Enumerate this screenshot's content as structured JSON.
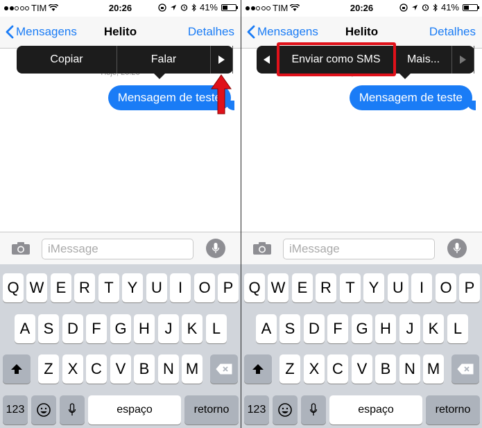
{
  "status_bar": {
    "carrier": "TIM",
    "time": "20:26",
    "battery": "41%",
    "battery_level": 0.41
  },
  "nav": {
    "back_label": "Mensagens",
    "title": "Helito",
    "details_label": "Detalhes"
  },
  "conversation": {
    "timestamp": "Hoje, 20:26",
    "message": "Mensagem de teste"
  },
  "left_menu": {
    "items": [
      "Copiar",
      "Falar"
    ]
  },
  "right_menu": {
    "items": [
      "Enviar como SMS",
      "Mais..."
    ]
  },
  "input": {
    "placeholder": "iMessage"
  },
  "keyboard": {
    "row1": [
      "Q",
      "W",
      "E",
      "R",
      "T",
      "Y",
      "U",
      "I",
      "O",
      "P"
    ],
    "row2": [
      "A",
      "S",
      "D",
      "F",
      "G",
      "H",
      "J",
      "K",
      "L"
    ],
    "row3": [
      "Z",
      "X",
      "C",
      "V",
      "B",
      "N",
      "M"
    ],
    "numbers_label": "123",
    "space_label": "espaço",
    "return_label": "retorno"
  },
  "colors": {
    "accent": "#1a7cf6",
    "highlight": "#e0111a",
    "arrow": "#e0111a"
  }
}
